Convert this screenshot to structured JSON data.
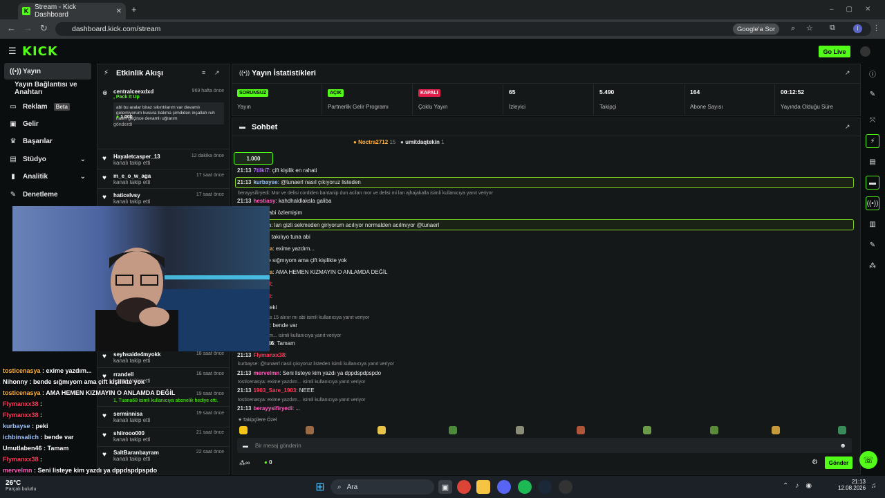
{
  "browser": {
    "tab_title": "Stream - Kick Dashboard",
    "url": "dashboard.kick.com/stream",
    "google_btn": "Google'a Sor"
  },
  "header": {
    "logo": "KICK",
    "go_live": "Go Live"
  },
  "sidebar": {
    "items": [
      {
        "label": "Yayın",
        "icon": "broadcast-icon"
      },
      {
        "label": "Yayın Bağlantısı ve Anahtarı"
      },
      {
        "label": "Reklam",
        "badge": "Beta",
        "icon": "monitor-icon"
      },
      {
        "label": "Gelir",
        "icon": "money-icon"
      },
      {
        "label": "Başarılar",
        "icon": "trophy-icon"
      },
      {
        "label": "Stüdyo",
        "icon": "studio-icon"
      },
      {
        "label": "Analitik",
        "icon": "chart-icon"
      },
      {
        "label": "Denetleme",
        "icon": "wrench-icon"
      }
    ]
  },
  "activity": {
    "title": "Etkinlik Akışı",
    "items": [
      {
        "name": "centralceexdxd",
        "time": "969 hafta önce",
        "sub": ", Pack It Up",
        "msg": "abi bu aralar biraz sıkıntılarım var devamlı gelemiyorum kusura bakma şimdiden inşallah ruh halim geçince devamlı uğrarım",
        "amount": "1.000",
        "foot": "gönderdi"
      },
      {
        "name": "Hayaletcasper_13",
        "time": "12 dakika önce",
        "sub": "kanalı takip etti"
      },
      {
        "name": "m_e_o_w_aga",
        "time": "17 saat önce",
        "sub": "kanalı takip etti"
      },
      {
        "name": "haticelvsy",
        "time": "17 saat önce",
        "sub": "kanalı takip etti"
      },
      {
        "name": "seyhsaide4myokk",
        "time": "18 saat önce",
        "sub": "kanalı takip etti"
      },
      {
        "name": "rrandell",
        "time": "18 saat önce",
        "sub": "kanalı takip etti"
      },
      {
        "name": "",
        "time": "19 saat önce",
        "sub": "1, Tuana68 isimli kullanıcıya abonelik hediye etti."
      },
      {
        "name": "serminnisa",
        "time": "19 saat önce",
        "sub": "kanalı takip etti"
      },
      {
        "name": "shiirooo000",
        "time": "21 saat önce",
        "sub": "kanalı takip etti"
      },
      {
        "name": "SaltBaranbayram",
        "time": "22 saat önce",
        "sub": "kanalı takip etti"
      }
    ]
  },
  "stats": {
    "title": "Yayın İstatistikleri",
    "cells": [
      {
        "value": "SORUNSUZ",
        "label": "Yayın",
        "color": "#53fc18",
        "pill": true
      },
      {
        "value": "AÇIK",
        "label": "Partnerlik Gelir Programı",
        "color": "#53fc18",
        "pill": true
      },
      {
        "value": "KAPALI",
        "label": "Çoklu Yayın",
        "color": "#e0204b",
        "pill": true
      },
      {
        "value": "65",
        "label": "İzleyici"
      },
      {
        "value": "5.490",
        "label": "Takipçi"
      },
      {
        "value": "164",
        "label": "Abone Sayısı"
      },
      {
        "value": "00:12:52",
        "label": "Yayında Olduğu Süre"
      }
    ]
  },
  "chat": {
    "title": "Sohbet",
    "top_user1": "Noctra2712",
    "top_count1": "15",
    "top_user2": "umitdaqtekin",
    "top_count2": "1",
    "pinned_amount": "1.000",
    "placeholder": "Bir mesaj gönderin",
    "send": "Gönder",
    "emote_label": "Takipçilere Özel",
    "points": "0",
    "lines": [
      {
        "time": "21:13",
        "user": "7tilki7",
        "color": "#b36bff",
        "msg": "çift kişilik en rahati"
      },
      {
        "time": "21:13",
        "user": "kurbayse",
        "color": "#9ec5ff",
        "msg": "@tunaerl nasıl çıkıyoruz listeden",
        "hl": true
      },
      {
        "reply": "berayysifiryedi: Mor ve delisi cordiden bantanip dun acilan mor ve delisi mi lan ajhajakalla isimli kullanıcıya yanıt veriyor"
      },
      {
        "time": "21:13",
        "user": "hestiasy",
        "color": "#ff5ebc",
        "msg": "kahdhaldlaksla galiba"
      },
      {
        "time": "",
        "user": "_ve_delisi",
        "color": "#ff5ebc",
        "msg": "abi özlemişim"
      },
      {
        "time": "",
        "user": "ichbinsalich",
        "color": "#9ec5ff",
        "msg": "lan gizli sekmeden giriyorum acılıyor normalden acılmıyor @tunaerl",
        "hl": true
      },
      {
        "time": "",
        "user": "sevval_ii",
        "color": "#ff5ebc",
        "msg": "fri takılıyo tuna abi"
      },
      {
        "time": "",
        "user": "tosticenasya",
        "color": "#ffb23f",
        "msg": "exime yazdım..."
      },
      {
        "time": "",
        "user": "onny",
        "color": "#ffffff",
        "msg": "bende sığmıyom ama çift kişilikte yok"
      },
      {
        "time": "",
        "user": "tosticenasya",
        "color": "#ffb23f",
        "msg": "AMA HEMEN KIZMAYIN O ANLAMDA DEĞİL"
      },
      {
        "time": "",
        "user": "Flymanxx38",
        "color": "#ff3b5c",
        "msg": ""
      },
      {
        "time": "",
        "user": "Flymanxx38",
        "color": "#ff3b5c",
        "msg": ""
      },
      {
        "time": "",
        "user": "kurbayse",
        "color": "#9ec5ff",
        "msg": "peki"
      },
      {
        "reply": "er_13: hp victus 15 alınır mı abi isimli kullanıcıya yanıt veriyor"
      },
      {
        "time": "",
        "user": "chbinsalich",
        "color": "#9ec5ff",
        "msg": "bende var"
      },
      {
        "reply": "a: exime yazdım... isimli kullanıcıya yanıt veriyor"
      },
      {
        "time": "",
        "user": "Umutlaben46",
        "color": "#ffffff",
        "msg": "Tamam"
      },
      {
        "time": "21:13",
        "user": "Flymanxx38",
        "color": "#ff3b5c",
        "msg": ""
      },
      {
        "reply": "kurbayse: @tunaerl nasıl çıkıyoruz listeden isimli kullanıcıya yanıt veriyor"
      },
      {
        "time": "21:13",
        "user": "mervelmn",
        "color": "#ff5ebc",
        "msg": "Seni listeye kim yazdı ya dppdspdpspdo"
      },
      {
        "reply": "tosticenasya: exime yazdım... isimli kullanıcıya yanıt veriyor"
      },
      {
        "time": "21:13",
        "user": "1903_Sare_1903",
        "color": "#ff3b5c",
        "msg": "NEEE"
      },
      {
        "reply": "tosticenasya: exime yazdım... isimli kullanıcıya yanıt veriyor"
      },
      {
        "time": "21:13",
        "user": "berayysifiryedi",
        "color": "#ff5ebc",
        "msg": "..."
      }
    ]
  },
  "overlay_chat": [
    {
      "user": "tosticenasya",
      "color": "#ffb23f",
      "msg": "exime yazdım..."
    },
    {
      "user": "Nihonny",
      "color": "#ffffff",
      "msg": "bende sığmıyom ama çift kişilikte yok"
    },
    {
      "user": "tosticenasya",
      "color": "#ffb23f",
      "msg": "AMA HEMEN KIZMAYIN O ANLAMDA DEĞİL"
    },
    {
      "user": "Flymanxx38",
      "color": "#ff3b5c",
      "msg": ""
    },
    {
      "user": "Flymanxx38",
      "color": "#ff3b5c",
      "msg": ""
    },
    {
      "user": "kurbayse",
      "color": "#9ec5ff",
      "msg": "peki"
    },
    {
      "user": "ichbinsalich",
      "color": "#9ec5ff",
      "msg": "bende var"
    },
    {
      "user": "Umutlaben46",
      "color": "#ffffff",
      "msg": "Tamam"
    },
    {
      "user": "Flymanxx38",
      "color": "#ff3b5c",
      "msg": ""
    },
    {
      "user": "mervelmn",
      "color": "#ff5ebc",
      "msg": "Seni listeye kim yazdı ya dppdspdpspdo"
    },
    {
      "user": "1903_Sare_1903",
      "color": "#ff3b5c",
      "msg": "NEEE"
    },
    {
      "user": "berayysifiryedi",
      "color": "#ff5ebc",
      "msg": "..."
    }
  ],
  "taskbar": {
    "search": "Ara",
    "time": "21:13",
    "date": "12.08.2026",
    "weather": "26°C",
    "weather_sub": "Parçalı bulutlu"
  }
}
